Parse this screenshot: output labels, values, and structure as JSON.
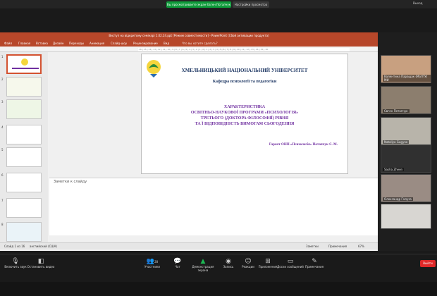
{
  "zoom_bar": {
    "share_text": "Вы просматриваете экран Євген Потапчук",
    "view_options": "Настройки просмотра",
    "exit_full": "Выход"
  },
  "powerpoint": {
    "window_title": "Виступ на відкритому семінарі 1.02.24.ppt [Режим совместимости] - PowerPoint (Сбой активации продукта)",
    "tabs": [
      "Файл",
      "Главная",
      "Вставка",
      "Дизайн",
      "Переходы",
      "Анимация",
      "Слайд-шоу",
      "Рецензирование",
      "Вид"
    ],
    "search_placeholder": "Что вы хотите сделать?",
    "share_button": "Общий доступ",
    "user_label": "Вход",
    "notes_placeholder": "Заметки к слайду",
    "status_slide": "Слайд 1 из 16",
    "status_lang": "английский (США)",
    "status_notes": "Заметки",
    "status_comments": "Примечания",
    "zoom_level": "67%",
    "ruler_text": "·16·|·15·|·14·|·13·|·12·|·11·|·10·|·9·|·8·|·7·|·6·|·5·|·4·|·3·|·2·|·1·|·0·|·1·|·2·|·3·|·4·|·5·|·6·|·7·|·8·|·9·|·10·|·11·|·12·|·13·|·14·|·15·|·16·",
    "slide_numbers": [
      "1",
      "2",
      "3",
      "4",
      "5",
      "6",
      "7",
      "8"
    ]
  },
  "slide": {
    "university": "ХМЕЛЬНИЦЬКИЙ НАЦІОНАЛЬНИЙ УНІВЕРСИТЕТ",
    "department": "Кафедра психології та педагогіки",
    "title_lines": [
      "ХАРАКТЕРИСТИКА",
      "ОСВІТНЬО-НАУКОВОЇ ПРОГРАМИ «ПСИХОЛОГІЯ»",
      "ТРЕТЬОГО (ДОКТОРА ФІЛОСОФІЇ) РІВНЯ",
      "ТА Ї ВІДПОВІДНІСТЬ ВИМОГАМ СЬОГОДЕННЯ"
    ],
    "guarantor": "Гарант ОНП «Психологія» Потапчук Є. М.",
    "title_color": "#7030a0",
    "header_color": "#1f3864"
  },
  "participants": [
    {
      "name": "Валентина Паращак (МатПУ) МИ",
      "bg": "#c8a080"
    },
    {
      "name": "Євген Потапчук",
      "bg": "#8c7e6e"
    },
    {
      "name": "Nataliya Gugyna",
      "bg": "#b8b4aa"
    },
    {
      "name": "Sasha Zheen",
      "bg": "#303030"
    },
    {
      "name": "Олександр Галуза",
      "bg": "#9a8c84"
    },
    {
      "name": "",
      "bg": "#d8d6d2"
    }
  ],
  "toolbar": {
    "mute": "Включить звук",
    "video": "Остановить видео",
    "participants": "Участники",
    "participants_count": "28",
    "chat": "Чат",
    "share": "Демонстрация экрана",
    "record": "Запись",
    "reactions": "Реакции",
    "apps": "Приложения",
    "whiteboard": "Доски сообщений",
    "notes": "Примечания",
    "end": "Выйти"
  }
}
